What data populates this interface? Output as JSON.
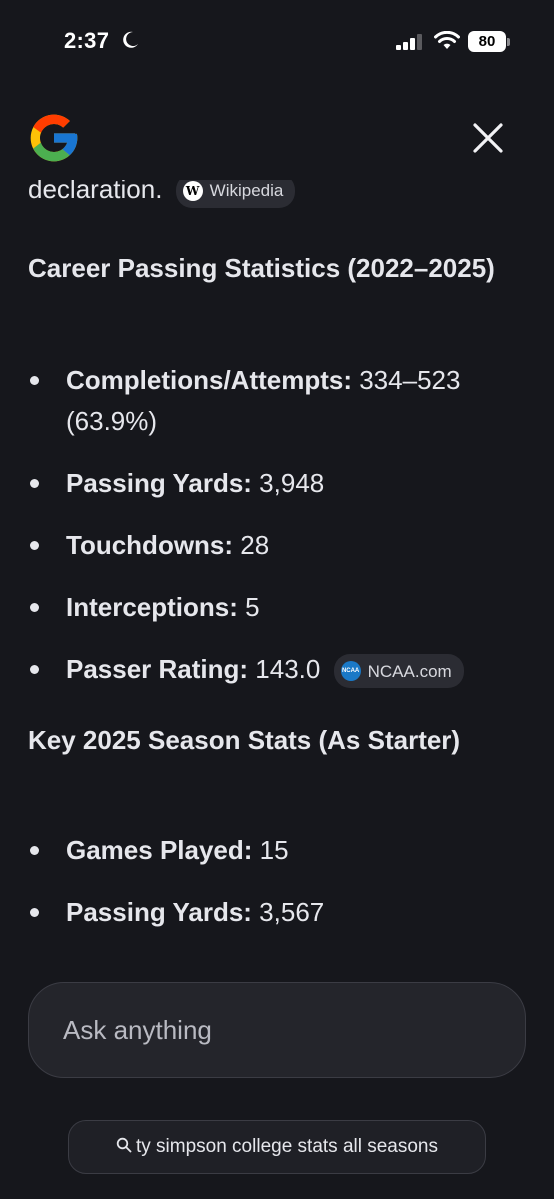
{
  "status_bar": {
    "time": "2:37",
    "battery": "80"
  },
  "content": {
    "truncated_text": "declaration.",
    "wikipedia_chip": "Wikipedia",
    "career_heading": "Career Passing Statistics (2022–2025)",
    "career_stats": [
      {
        "label": "Completions/Attempts:",
        "value": " 334–523 (63.9%)"
      },
      {
        "label": "Passing Yards:",
        "value": " 3,948"
      },
      {
        "label": "Touchdowns:",
        "value": " 28"
      },
      {
        "label": "Interceptions:",
        "value": " 5"
      },
      {
        "label": "Passer Rating:",
        "value": " 143.0"
      }
    ],
    "ncaa_chip": "NCAA.com",
    "season_heading": "Key 2025 Season Stats (As Starter)",
    "season_stats": [
      {
        "label": "Games Played:",
        "value": " 15"
      },
      {
        "label": "Passing Yards:",
        "value": " 3,567"
      }
    ]
  },
  "ask_input": {
    "placeholder": "Ask anything"
  },
  "suggestion": {
    "label": "ty simpson college stats all seasons"
  },
  "icons": {
    "logo": "google-g-logo",
    "close": "close-icon",
    "search": "search-icon"
  }
}
